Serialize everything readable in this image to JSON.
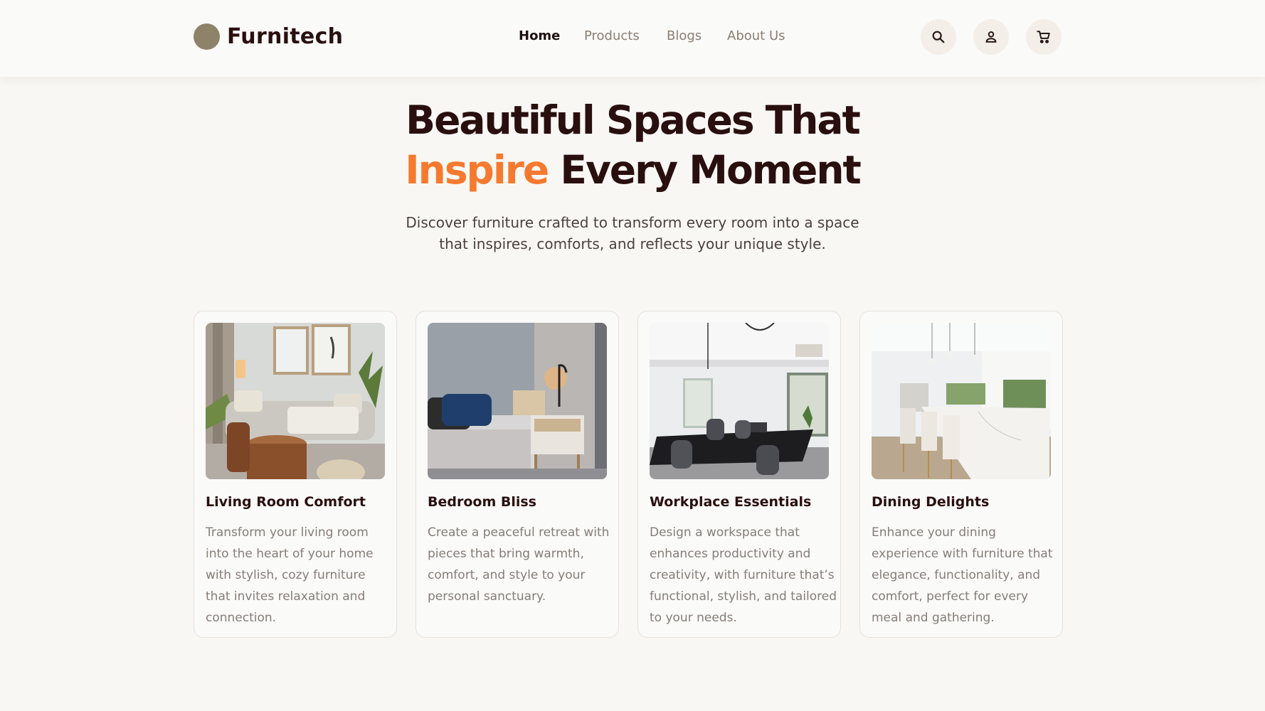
{
  "brand": {
    "name": "Furnitech",
    "logo_color": "#8e8268"
  },
  "nav": {
    "items": [
      {
        "label": "Home",
        "active": true
      },
      {
        "label": "Products",
        "active": false
      },
      {
        "label": "Blogs",
        "active": false
      },
      {
        "label": "About Us",
        "active": false
      }
    ]
  },
  "header_icons": [
    "search-icon",
    "user-icon",
    "cart-icon"
  ],
  "hero": {
    "title_line1": "Beautiful Spaces That",
    "title_accent": "Inspire",
    "title_line2_rest": " Every Moment",
    "subtitle_line1": "Discover furniture crafted to transform every room into a space",
    "subtitle_line2": "that inspires, comforts, and reflects your unique style.",
    "accent_color": "#f57a2f"
  },
  "cards": [
    {
      "title": "Living Room Comfort",
      "desc_lines": [
        "Transform your living room",
        "into the heart of your home",
        "with stylish, cozy furniture",
        "that invites relaxation and",
        "connection."
      ]
    },
    {
      "title": "Bedroom Bliss",
      "desc_lines": [
        "Create a peaceful retreat with",
        "pieces that bring warmth,",
        "comfort, and style to your",
        "personal sanctuary."
      ]
    },
    {
      "title": "Workplace Essentials",
      "desc_lines": [
        "Design a workspace that",
        "enhances productivity and",
        "creativity, with furniture that’s",
        "functional, stylish, and tailored",
        "to your needs."
      ]
    },
    {
      "title": "Dining Delights",
      "desc_lines": [
        "Enhance your dining",
        "experience with furniture that",
        "elegance, functionality, and",
        "comfort, perfect for every",
        "meal and gathering."
      ]
    }
  ]
}
